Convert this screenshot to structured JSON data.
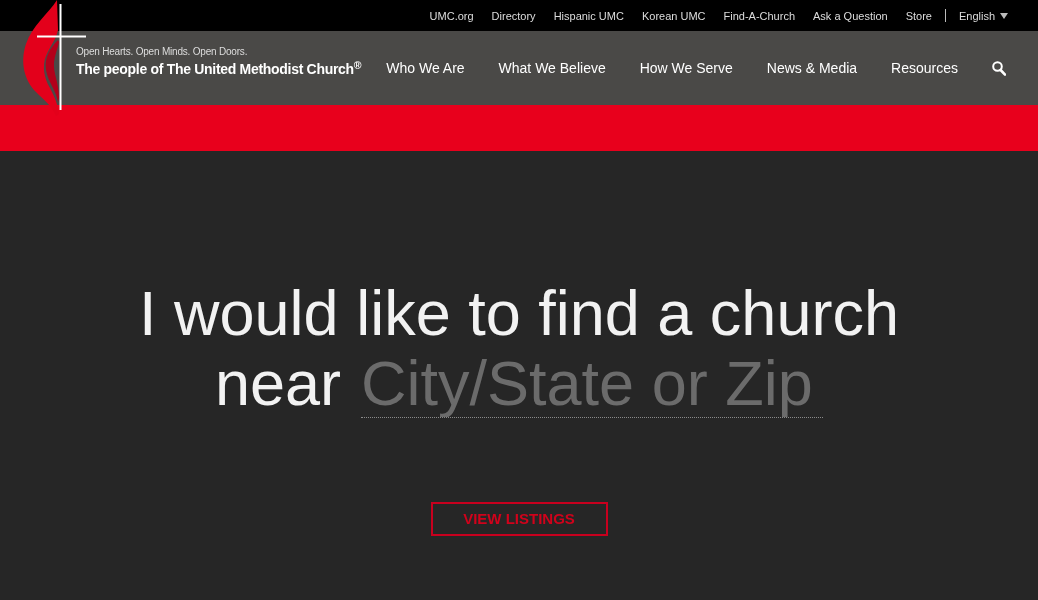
{
  "utility_nav": {
    "links": [
      "UMC.org",
      "Directory",
      "Hispanic UMC",
      "Korean UMC",
      "Find-A-Church",
      "Ask a Question",
      "Store"
    ],
    "language": {
      "label": "English"
    }
  },
  "header": {
    "tagline": "Open Hearts. Open Minds. Open Doors.",
    "wordmark": "The people of The United Methodist Church$^{®}$"
  },
  "main_nav": {
    "items": [
      "Who We Are",
      "What We Believe",
      "How We Serve",
      "News & Media",
      "Resources"
    ]
  },
  "hero": {
    "headline": "I would like to find a church",
    "lead": "near",
    "location_field": {
      "placeholder": "City/State or Zip"
    },
    "button": "VIEW LISTINGS"
  }
}
